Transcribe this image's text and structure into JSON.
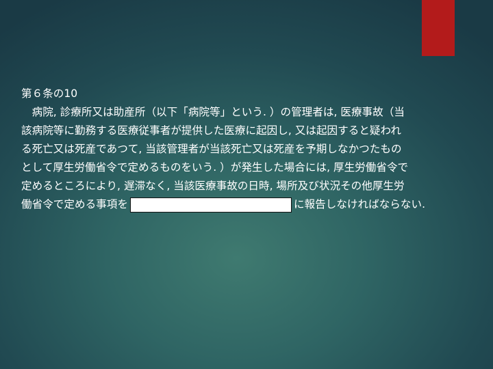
{
  "slide": {
    "heading": "第６条の10",
    "lines": [
      "　病院, 診療所又は助産所（以下「病院等」という. ）の管理者は, 医療事故（当",
      "該病院等に勤務する医療従事者が提供した医療に起因し, 又は起因すると疑われ",
      "る死亡又は死産であつて, 当該管理者が当該死亡又は死産を予期しなかつたもの",
      "として厚生労働省令で定めるものをいう. ）が発生した場合には, 厚生労働省令で",
      "定めるところにより, 遅滞なく, 当該医療事故の日時, 場所及び状況その他厚生労"
    ],
    "last_line_before": "働省令で定める事項を",
    "last_line_after": "に報告しなければならない."
  },
  "colors": {
    "accent": "#b31b1b",
    "background": "#2f6564",
    "text": "#ffffff"
  }
}
